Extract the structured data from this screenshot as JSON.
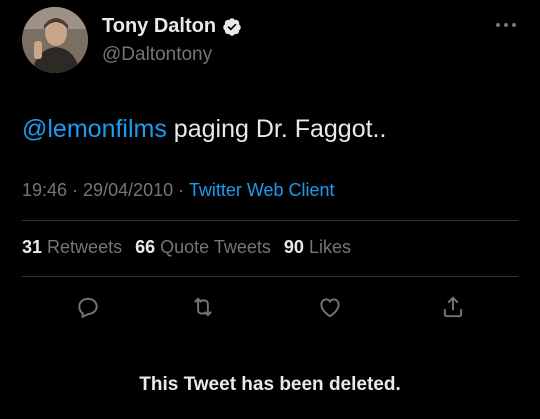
{
  "user": {
    "name": "Tony Dalton",
    "handle": "@Daltontony"
  },
  "tweet": {
    "mention": "@lemonfilms",
    "text": " paging Dr. Faggot.."
  },
  "meta": {
    "time": "19:46",
    "sep1": " · ",
    "date": "29/04/2010",
    "sep2": " · ",
    "client": "Twitter Web Client"
  },
  "stats": {
    "retweets_count": "31",
    "retweets_label": "Retweets",
    "quotes_count": "66",
    "quotes_label": "Quote Tweets",
    "likes_count": "90",
    "likes_label": "Likes"
  },
  "actions": [
    "reply-icon",
    "retweet-icon",
    "like-icon",
    "share-icon"
  ],
  "colors": {
    "accent": "#1d9bf0",
    "muted": "#71767b",
    "text": "#e7e9ea",
    "bg": "#000000"
  },
  "status": {
    "deleted_text": "This Tweet has been deleted."
  }
}
